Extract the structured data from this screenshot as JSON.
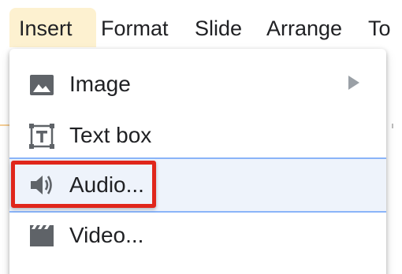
{
  "menubar": {
    "items": [
      {
        "label": "Insert",
        "active": true
      },
      {
        "label": "Format"
      },
      {
        "label": "Slide"
      },
      {
        "label": "Arrange"
      },
      {
        "label": "To"
      }
    ]
  },
  "insert_menu": {
    "items": [
      {
        "label": "Image",
        "icon": "image-icon",
        "has_submenu": true
      },
      {
        "label": "Text box",
        "icon": "text-box-icon"
      },
      {
        "label": "Audio...",
        "icon": "speaker-icon",
        "highlighted": true
      },
      {
        "label": "Video...",
        "icon": "video-clapper-icon"
      }
    ]
  },
  "colors": {
    "active_menu_bg": "#fdf1d0",
    "hover_row_bg": "#eef3fb",
    "hover_row_border": "#8ab4f8",
    "callout_red": "#e0261b",
    "icon_gray": "#5f6368"
  }
}
